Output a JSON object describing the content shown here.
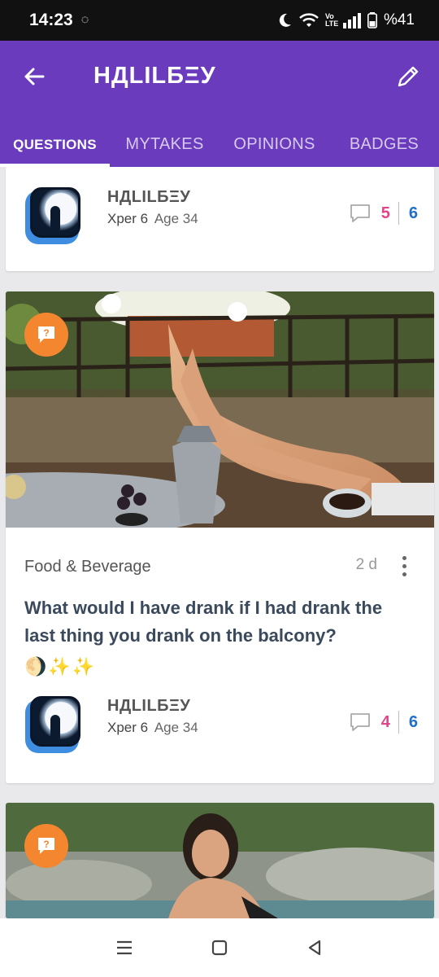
{
  "status_bar": {
    "time": "14:23",
    "battery": "%41",
    "volte": "Vo LTE"
  },
  "header": {
    "title": "НДLILБΞУ"
  },
  "tabs": [
    {
      "label": "QUESTIONS",
      "active": true
    },
    {
      "label": "MYTAKES",
      "active": false
    },
    {
      "label": "OPINIONS",
      "active": false
    },
    {
      "label": "BADGES",
      "active": false
    }
  ],
  "cards": [
    {
      "author": {
        "name": "НДLILБΞУ",
        "xper": "Xper 6",
        "age": "Age 34"
      },
      "stats": {
        "opinions": "5",
        "answers": "6"
      }
    },
    {
      "category": "Food & Beverage",
      "time_ago": "2 d",
      "question": "What would I have drank if I had drank the last thing you drank on the balcony?",
      "emojis": [
        "🌖",
        "✨",
        "✨"
      ],
      "author": {
        "name": "НДLILБΞУ",
        "xper": "Xper 6",
        "age": "Age 34"
      },
      "stats": {
        "opinions": "4",
        "answers": "6"
      }
    }
  ],
  "colors": {
    "header": "#6a3cbd",
    "badge": "#f3862f",
    "opinions": "#e0458a",
    "answers": "#1e70c8"
  }
}
